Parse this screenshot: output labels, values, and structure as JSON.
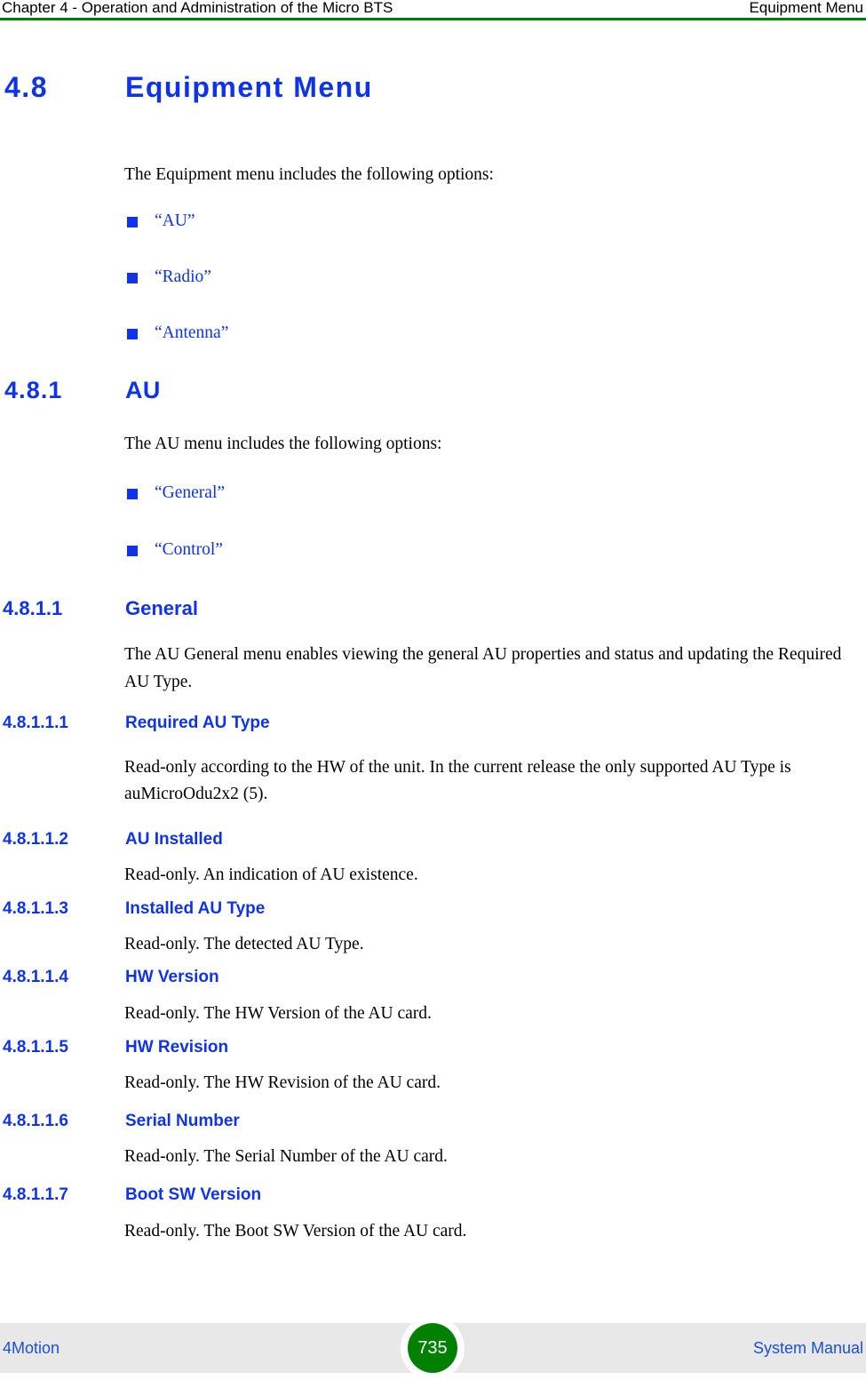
{
  "header": {
    "left": "Chapter 4 - Operation and Administration of the Micro BTS",
    "right": "Equipment Menu",
    "rule_color": "#007f00"
  },
  "colors": {
    "heading_blue": "#0f33ec",
    "link_blue": "#1a4fe0",
    "rule_green": "#007f00",
    "page_badge_green": "#008000",
    "footer_band": "#e8e8e8"
  },
  "sections": {
    "s48": {
      "number": "4.8",
      "title": "Equipment Menu",
      "intro": "The Equipment menu includes the following options:",
      "options": [
        "“AU”",
        "“Radio”",
        "“Antenna”"
      ]
    },
    "s481": {
      "number": "4.8.1",
      "title": "AU",
      "intro": "The AU menu includes the following options:",
      "options": [
        "“General”",
        "“Control”"
      ]
    },
    "s4811": {
      "number": "4.8.1.1",
      "title": "General",
      "body": "The AU General menu enables viewing the general AU properties and status and updating the Required AU Type."
    },
    "s48111": {
      "number": "4.8.1.1.1",
      "title": "Required AU Type",
      "body": "Read-only according to the HW of the unit. In the current release the only supported AU Type is auMicroOdu2x2 (5)."
    },
    "s48112": {
      "number": "4.8.1.1.2",
      "title": "AU Installed",
      "body": "Read-only. An indication of AU existence."
    },
    "s48113": {
      "number": "4.8.1.1.3",
      "title": "Installed AU Type",
      "body": "Read-only. The detected AU Type."
    },
    "s48114": {
      "number": "4.8.1.1.4",
      "title": "HW Version",
      "body": "Read-only. The HW Version of the AU card."
    },
    "s48115": {
      "number": "4.8.1.1.5",
      "title": "HW Revision",
      "body": "Read-only. The HW Revision of the AU card."
    },
    "s48116": {
      "number": "4.8.1.1.6",
      "title": "Serial Number",
      "body": "Read-only. The Serial Number of the AU card."
    },
    "s48117": {
      "number": "4.8.1.1.7",
      "title": "Boot SW Version",
      "body": "Read-only. The Boot SW Version of the AU card."
    }
  },
  "footer": {
    "left": "4Motion",
    "page_number": "735",
    "right": "System Manual"
  }
}
